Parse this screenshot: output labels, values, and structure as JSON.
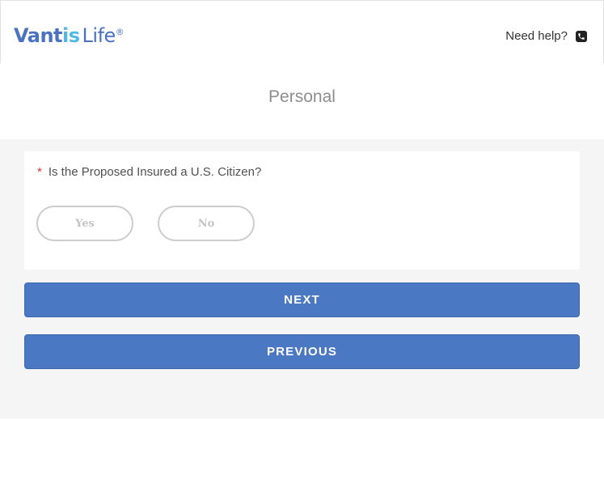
{
  "header": {
    "logo": {
      "part1": "Vant",
      "part2": "is",
      "part3": "Life",
      "reg": "®"
    },
    "help_label": "Need help?",
    "help_icon": "phone-icon"
  },
  "page": {
    "title": "Personal"
  },
  "question": {
    "required_marker": "*",
    "text": "Is the Proposed Insured a U.S. Citizen?",
    "options": [
      "Yes",
      "No"
    ]
  },
  "buttons": {
    "next": "NEXT",
    "previous": "PREVIOUS"
  },
  "colors": {
    "brand_blue": "#4a72c0",
    "brand_light_blue": "#52b9e4",
    "button_blue": "#4a78c2",
    "required_red": "#e0312b"
  }
}
